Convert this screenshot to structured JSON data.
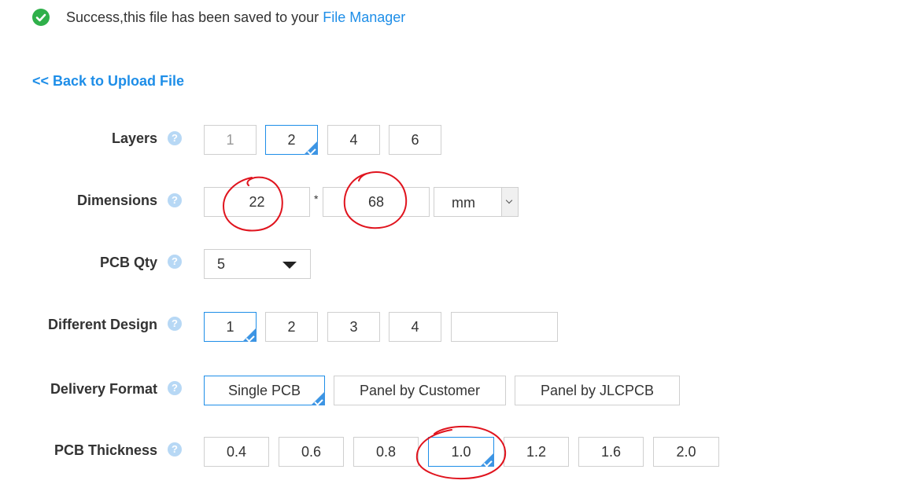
{
  "success": {
    "message": "Success,this file has been saved to your",
    "link": "File Manager"
  },
  "back_link": "<< Back to Upload File",
  "help_glyph": "?",
  "rows": {
    "layers": {
      "label": "Layers",
      "options": [
        "1",
        "2",
        "4",
        "6"
      ],
      "selected": "2",
      "disabled": [
        "1"
      ]
    },
    "dimensions": {
      "label": "Dimensions",
      "width": "22",
      "height": "68",
      "separator": "*",
      "unit": "mm"
    },
    "qty": {
      "label": "PCB Qty",
      "value": "5"
    },
    "design": {
      "label": "Different Design",
      "options": [
        "1",
        "2",
        "3",
        "4"
      ],
      "selected": "1",
      "custom_value": ""
    },
    "delivery": {
      "label": "Delivery Format",
      "options": [
        "Single PCB",
        "Panel by Customer",
        "Panel by JLCPCB"
      ],
      "selected": "Single PCB"
    },
    "thickness": {
      "label": "PCB Thickness",
      "options": [
        "0.4",
        "0.6",
        "0.8",
        "1.0",
        "1.2",
        "1.6",
        "2.0"
      ],
      "selected": "1.0"
    }
  },
  "colors": {
    "accent": "#1e8ee8",
    "success": "#2fb04a",
    "annotation": "#e0141e"
  }
}
